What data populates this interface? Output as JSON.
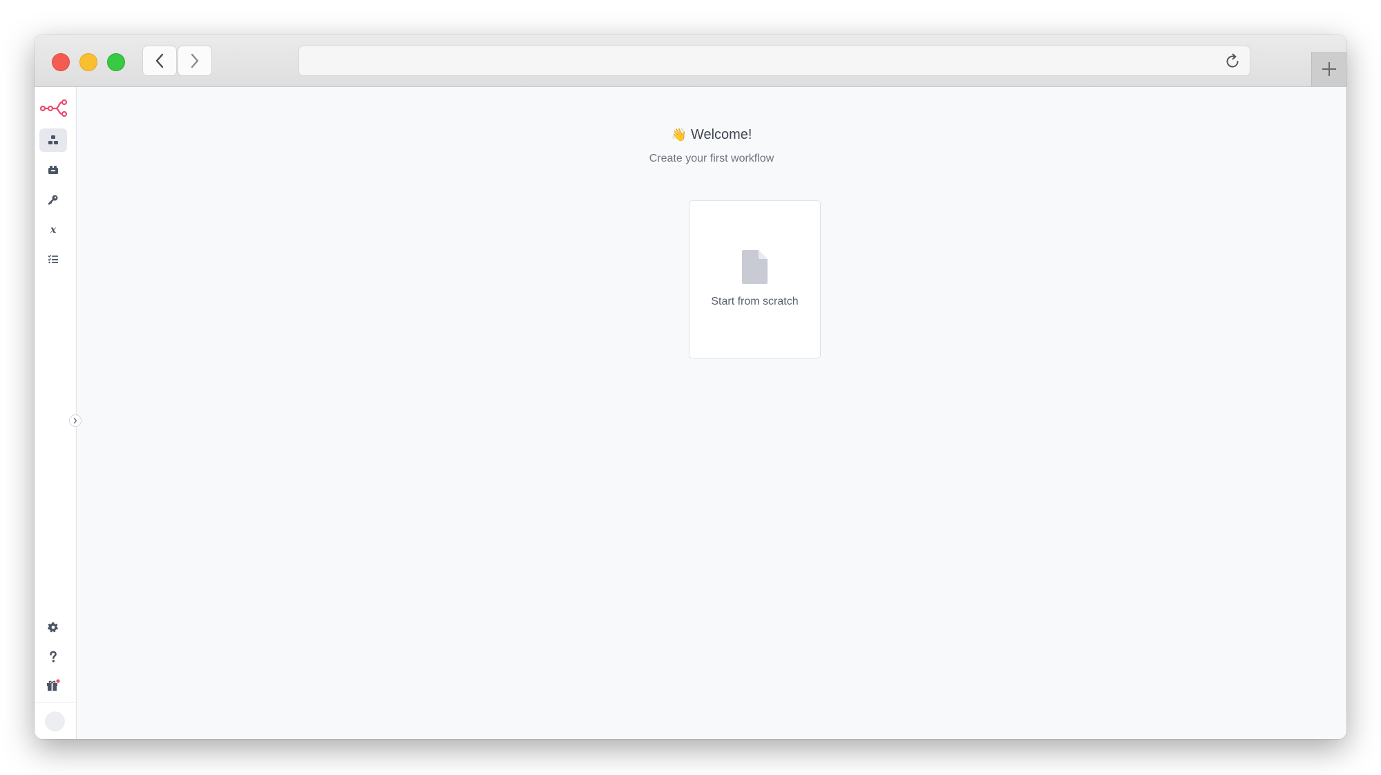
{
  "browser": {
    "url": "",
    "icons": {
      "back": "chevron-left-icon",
      "forward": "chevron-right-icon",
      "reload": "reload-icon",
      "new_tab": "plus-icon"
    }
  },
  "sidebar": {
    "brand_color": "#ea4b71",
    "items": [
      {
        "name": "workflows",
        "icon": "workflows-icon",
        "active": true
      },
      {
        "name": "templates",
        "icon": "templates-icon",
        "active": false
      },
      {
        "name": "credentials",
        "icon": "key-icon",
        "active": false
      },
      {
        "name": "variables",
        "icon": "variable-icon",
        "active": false
      },
      {
        "name": "executions",
        "icon": "list-check-icon",
        "active": false
      }
    ],
    "bottom_items": [
      {
        "name": "settings",
        "icon": "gear-icon"
      },
      {
        "name": "help",
        "icon": "question-icon"
      },
      {
        "name": "whats-new",
        "icon": "gift-icon",
        "notification": true
      }
    ]
  },
  "main": {
    "welcome_emoji": "👋",
    "welcome_title": "Welcome!",
    "subtitle": "Create your first workflow",
    "card": {
      "label": "Start from scratch",
      "icon": "file-icon"
    }
  }
}
